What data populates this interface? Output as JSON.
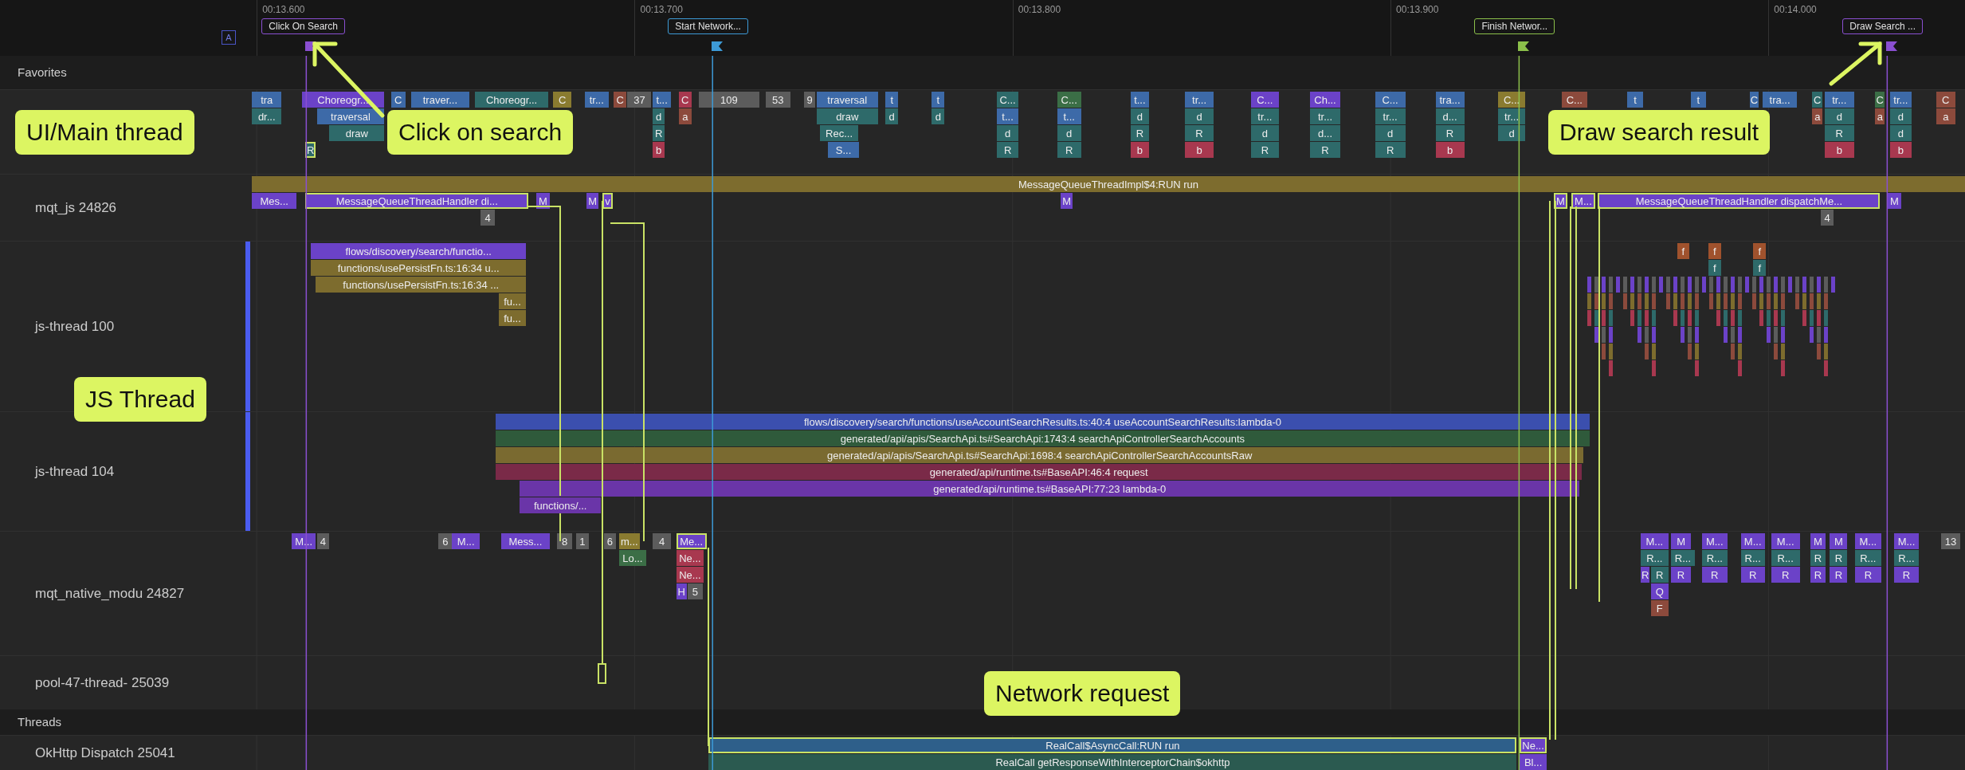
{
  "timeline": {
    "badge": "A",
    "ticks": [
      "00:13.600",
      "00:13.700",
      "00:13.800",
      "00:13.900",
      "00:14.000"
    ],
    "markers": [
      {
        "label": "Click On Search",
        "color": "#8a4fd1"
      },
      {
        "label": "Start Network...",
        "color": "#3d9ad6"
      },
      {
        "label": "Finish Networ...",
        "color": "#8cc04a"
      },
      {
        "label": "Draw Search ...",
        "color": "#8a4fd1"
      }
    ]
  },
  "tracks": [
    {
      "kind": "header",
      "label": "Favorites"
    },
    {
      "kind": "track",
      "bracketed": false,
      "lanes": [
        {
          "slices": [
            {
              "text": "tra",
              "color": "#3d6aa8",
              "outlined": false
            },
            {
              "text": "Choreogr...",
              "color": "#6b42c8",
              "outlined": false
            },
            {
              "text": "C",
              "color": "#3d6aa8",
              "outlined": false
            },
            {
              "text": "traver...",
              "color": "#3d6aa8",
              "outlined": false
            },
            {
              "text": "Choreogr...",
              "color": "#2e6a6a",
              "outlined": false
            },
            {
              "text": "C",
              "color": "#8a7b30",
              "outlined": false
            },
            {
              "text": "tr...",
              "color": "#3d6aa8",
              "outlined": false
            },
            {
              "text": "C",
              "color": "#8c4a3c",
              "outlined": false
            },
            {
              "text": "37",
              "color": "#5c5c5c",
              "outlined": false
            },
            {
              "text": "t...",
              "color": "#3d6aa8",
              "outlined": false
            },
            {
              "text": "C",
              "color": "#a8384f",
              "outlined": false
            },
            {
              "text": "109",
              "color": "#5c5c5c",
              "outlined": false
            },
            {
              "text": "53",
              "color": "#5c5c5c",
              "outlined": false
            },
            {
              "text": "9",
              "color": "#5c5c5c",
              "outlined": false
            },
            {
              "text": "traversal",
              "color": "#3d6aa8",
              "outlined": false
            },
            {
              "text": "t",
              "color": "#3d6aa8",
              "outlined": false
            },
            {
              "text": "t",
              "color": "#3d6aa8",
              "outlined": false
            },
            {
              "text": "C...",
              "color": "#2e6a6a",
              "outlined": false
            },
            {
              "text": "C...",
              "color": "#3b6e46",
              "outlined": false
            },
            {
              "text": "t...",
              "color": "#3d6aa8",
              "outlined": false
            },
            {
              "text": "tr...",
              "color": "#3d6aa8",
              "outlined": false
            },
            {
              "text": "C...",
              "color": "#6b42c8",
              "outlined": false
            },
            {
              "text": "Ch...",
              "color": "#6b42c8",
              "outlined": false
            },
            {
              "text": "C...",
              "color": "#3d6aa8",
              "outlined": false
            },
            {
              "text": "tra...",
              "color": "#3d6aa8",
              "outlined": false
            },
            {
              "text": "C...",
              "color": "#8a7b30",
              "outlined": false
            },
            {
              "text": "C...",
              "color": "#8c4a3c",
              "outlined": false
            },
            {
              "text": "t",
              "color": "#3d6aa8",
              "outlined": false
            },
            {
              "text": "t",
              "color": "#3d6aa8",
              "outlined": false
            },
            {
              "text": "C",
              "color": "#3d6aa8",
              "outlined": false
            },
            {
              "text": "tra...",
              "color": "#3d6aa8",
              "outlined": false
            },
            {
              "text": "C",
              "color": "#2e6a6a",
              "outlined": false
            },
            {
              "text": "tr...",
              "color": "#3d6aa8",
              "outlined": false
            },
            {
              "text": "C",
              "color": "#3b6e46",
              "outlined": false
            },
            {
              "text": "tr...",
              "color": "#3d6aa8",
              "outlined": false
            },
            {
              "text": "C",
              "color": "#8c4a3c",
              "outlined": false
            }
          ]
        },
        {
          "slices": [
            {
              "text": "dr...",
              "color": "#2e6a6a",
              "outlined": false
            },
            {
              "text": "traversal",
              "color": "#3d6aa8",
              "outlined": false
            },
            {
              "text": "d",
              "color": "#2e6a6a",
              "outlined": false
            },
            {
              "text": "a",
              "color": "#8c4a3c",
              "outlined": false
            },
            {
              "text": "draw",
              "color": "#2e6a6a",
              "outlined": false
            },
            {
              "text": "d",
              "color": "#2e6a6a",
              "outlined": false
            },
            {
              "text": "d",
              "color": "#2e6a6a",
              "outlined": false
            },
            {
              "text": "t...",
              "color": "#3d6aa8",
              "outlined": false
            },
            {
              "text": "t...",
              "color": "#3d6aa8",
              "outlined": false
            },
            {
              "text": "d",
              "color": "#2e6a6a",
              "outlined": false
            },
            {
              "text": "d",
              "color": "#2e6a6a",
              "outlined": false
            },
            {
              "text": "tr...",
              "color": "#2e6a6a",
              "outlined": false
            },
            {
              "text": "tr...",
              "color": "#2e6a6a",
              "outlined": false
            },
            {
              "text": "tr...",
              "color": "#2e6a6a",
              "outlined": false
            },
            {
              "text": "d...",
              "color": "#2e6a6a",
              "outlined": false
            },
            {
              "text": "tr...",
              "color": "#2e6a6a",
              "outlined": false
            },
            {
              "text": "a",
              "color": "#8c4a3c",
              "outlined": false
            },
            {
              "text": "d",
              "color": "#2e6a6a",
              "outlined": false
            },
            {
              "text": "a",
              "color": "#8c4a3c",
              "outlined": false
            },
            {
              "text": "d",
              "color": "#2e6a6a",
              "outlined": false
            },
            {
              "text": "a",
              "color": "#8c4a3c",
              "outlined": false
            }
          ]
        },
        {
          "slices": [
            {
              "text": "draw",
              "color": "#2e6a6a",
              "outlined": false
            },
            {
              "text": "R",
              "color": "#2e6a6a",
              "outlined": false
            },
            {
              "text": "Rec...",
              "color": "#2e6a6a",
              "outlined": false
            },
            {
              "text": "d",
              "color": "#2e6a6a",
              "outlined": false
            },
            {
              "text": "d",
              "color": "#2e6a6a",
              "outlined": false
            },
            {
              "text": "R",
              "color": "#2e6a6a",
              "outlined": false
            },
            {
              "text": "R",
              "color": "#2e6a6a",
              "outlined": false
            },
            {
              "text": "d",
              "color": "#2e6a6a",
              "outlined": false
            },
            {
              "text": "d...",
              "color": "#2e6a6a",
              "outlined": false
            },
            {
              "text": "d",
              "color": "#2e6a6a",
              "outlined": false
            },
            {
              "text": "R",
              "color": "#2e6a6a",
              "outlined": false
            },
            {
              "text": "d",
              "color": "#2e6a6a",
              "outlined": false
            },
            {
              "text": "R",
              "color": "#2e6a6a",
              "outlined": false
            },
            {
              "text": "d",
              "color": "#2e6a6a",
              "outlined": false
            }
          ]
        },
        {
          "slices": [
            {
              "text": "R",
              "color": "#2e6a6a",
              "outlined": true
            },
            {
              "text": "b",
              "color": "#a8384f",
              "outlined": false
            },
            {
              "text": "S...",
              "color": "#3d6aa8",
              "outlined": false
            },
            {
              "text": "R",
              "color": "#2e6a6a",
              "outlined": false
            },
            {
              "text": "R",
              "color": "#2e6a6a",
              "outlined": false
            },
            {
              "text": "b",
              "color": "#a8384f",
              "outlined": false
            },
            {
              "text": "b",
              "color": "#a8384f",
              "outlined": false
            },
            {
              "text": "R",
              "color": "#2e6a6a",
              "outlined": false
            },
            {
              "text": "R",
              "color": "#2e6a6a",
              "outlined": false
            },
            {
              "text": "R",
              "color": "#2e6a6a",
              "outlined": false
            },
            {
              "text": "b",
              "color": "#a8384f",
              "outlined": false
            },
            {
              "text": "b",
              "color": "#a8384f",
              "outlined": false
            },
            {
              "text": "b",
              "color": "#a8384f",
              "outlined": false
            }
          ]
        }
      ]
    },
    {
      "kind": "track",
      "label": "mqt_js 24826",
      "bracketed": false,
      "lanes": [
        {
          "slices": [
            {
              "text": "MessageQueueThreadImpl$4:RUN run",
              "color": "#7d6c2e",
              "outlined": false
            }
          ]
        },
        {
          "slices": [
            {
              "text": "Mes...",
              "color": "#6b42c8",
              "outlined": false
            },
            {
              "text": "MessageQueueThreadHandler di...",
              "color": "#6b42c8",
              "outlined": true
            },
            {
              "text": "M",
              "color": "#6b42c8",
              "outlined": false
            },
            {
              "text": "M",
              "color": "#6b42c8",
              "outlined": false
            },
            {
              "text": "v",
              "color": "#6b42c8",
              "outlined": true
            },
            {
              "text": "M",
              "color": "#6b42c8",
              "outlined": false
            },
            {
              "text": "M",
              "color": "#6b42c8",
              "outlined": true
            },
            {
              "text": "M...",
              "color": "#6b42c8",
              "outlined": true
            },
            {
              "text": "MessageQueueThreadHandler dispatchMe...",
              "color": "#6b42c8",
              "outlined": true
            },
            {
              "text": "M",
              "color": "#6b42c8",
              "outlined": false
            }
          ]
        },
        {
          "slices": [
            {
              "text": "4",
              "color": "#5c5c5c",
              "outlined": false
            },
            {
              "text": "4",
              "color": "#5c5c5c",
              "outlined": false
            }
          ]
        }
      ]
    },
    {
      "kind": "track",
      "label": "js-thread 100",
      "bracketed": true,
      "lanes": [
        {
          "slices": [
            {
              "text": "flows/discovery/search/functio...",
              "color": "#6b42c8",
              "outlined": false
            },
            {
              "text": "f",
              "color": "#a0522d",
              "outlined": false
            },
            {
              "text": "f",
              "color": "#a0522d",
              "outlined": false
            },
            {
              "text": "f",
              "color": "#a0522d",
              "outlined": false
            }
          ]
        },
        {
          "slices": [
            {
              "text": "functions/usePersistFn.ts:16:34 u...",
              "color": "#7d6c2e",
              "outlined": false
            },
            {
              "text": "f",
              "color": "#2e6a6a",
              "outlined": false
            },
            {
              "text": "f",
              "color": "#2e6a6a",
              "outlined": false
            }
          ]
        },
        {
          "slices": [
            {
              "text": "functions/usePersistFn.ts:16:34 ...",
              "color": "#7d6c2e",
              "outlined": false
            }
          ]
        },
        {
          "slices": [
            {
              "text": "fu...",
              "color": "#7d6c2e",
              "outlined": false
            }
          ]
        },
        {
          "slices": [
            {
              "text": "fu...",
              "color": "#7d6c2e",
              "outlined": false
            }
          ]
        }
      ]
    },
    {
      "kind": "track",
      "label": "js-thread 104",
      "bracketed": true,
      "lanes": [
        {
          "slices": [
            {
              "text": "flows/discovery/search/functions/useAccountSearchResults.ts:40:4 useAccountSearchResults:lambda-0",
              "color": "#3b4fae",
              "outlined": false
            }
          ]
        },
        {
          "slices": [
            {
              "text": "generated/api/apis/SearchApi.ts#SearchApi:1743:4 searchApiControllerSearchAccounts",
              "color": "#2f5a3b",
              "outlined": false
            }
          ]
        },
        {
          "slices": [
            {
              "text": "generated/api/apis/SearchApi.ts#SearchApi:1698:4 searchApiControllerSearchAccountsRaw",
              "color": "#7a6a30",
              "outlined": false
            }
          ]
        },
        {
          "slices": [
            {
              "text": "generated/api/runtime.ts#BaseAPI:46:4 request",
              "color": "#7a2a48",
              "outlined": false
            }
          ]
        },
        {
          "slices": [
            {
              "text": "generated/api/runtime.ts#BaseAPI:77:23 lambda-0",
              "color": "#6a35a8",
              "outlined": false
            }
          ]
        },
        {
          "slices": [
            {
              "text": "functions/...",
              "color": "#6a35a8",
              "outlined": false
            }
          ]
        }
      ]
    },
    {
      "kind": "track",
      "label": "mqt_native_modu 24827",
      "bracketed": false,
      "lanes": [
        {
          "slices": [
            {
              "text": "M...",
              "color": "#6b42c8",
              "outlined": false
            },
            {
              "text": "4",
              "color": "#5c5c5c",
              "outlined": false
            },
            {
              "text": "6",
              "color": "#5c5c5c",
              "outlined": false
            },
            {
              "text": "M...",
              "color": "#6b42c8",
              "outlined": false
            },
            {
              "text": "Mess...",
              "color": "#6b42c8",
              "outlined": false
            },
            {
              "text": "8",
              "color": "#5c5c5c",
              "outlined": false
            },
            {
              "text": "1",
              "color": "#5c5c5c",
              "outlined": false
            },
            {
              "text": "6",
              "color": "#5c5c5c",
              "outlined": false
            },
            {
              "text": "m...",
              "color": "#8a7b30",
              "outlined": false
            },
            {
              "text": "4",
              "color": "#5c5c5c",
              "outlined": false
            },
            {
              "text": "Me...",
              "color": "#6b42c8",
              "outlined": true
            },
            {
              "text": "M...",
              "color": "#6b42c8",
              "outlined": false
            },
            {
              "text": "M",
              "color": "#6b42c8",
              "outlined": false
            },
            {
              "text": "M...",
              "color": "#6b42c8",
              "outlined": false
            },
            {
              "text": "M...",
              "color": "#6b42c8",
              "outlined": false
            },
            {
              "text": "M...",
              "color": "#6b42c8",
              "outlined": false
            },
            {
              "text": "M",
              "color": "#6b42c8",
              "outlined": false
            },
            {
              "text": "M",
              "color": "#6b42c8",
              "outlined": false
            },
            {
              "text": "M...",
              "color": "#6b42c8",
              "outlined": false
            },
            {
              "text": "M...",
              "color": "#6b42c8",
              "outlined": false
            },
            {
              "text": "13",
              "color": "#5c5c5c",
              "outlined": false
            }
          ]
        },
        {
          "slices": [
            {
              "text": "Lo...",
              "color": "#3b6e46",
              "outlined": false
            },
            {
              "text": "Ne...",
              "color": "#a8384f",
              "outlined": false
            },
            {
              "text": "R...",
              "color": "#2e6a6a",
              "outlined": false
            },
            {
              "text": "R...",
              "color": "#2e6a6a",
              "outlined": false
            },
            {
              "text": "R...",
              "color": "#2e6a6a",
              "outlined": false
            },
            {
              "text": "R...",
              "color": "#2e6a6a",
              "outlined": false
            },
            {
              "text": "R...",
              "color": "#2e6a6a",
              "outlined": false
            },
            {
              "text": "R",
              "color": "#2e6a6a",
              "outlined": false
            },
            {
              "text": "R",
              "color": "#2e6a6a",
              "outlined": false
            },
            {
              "text": "R...",
              "color": "#2e6a6a",
              "outlined": false
            },
            {
              "text": "R...",
              "color": "#2e6a6a",
              "outlined": false
            }
          ]
        },
        {
          "slices": [
            {
              "text": "Ne...",
              "color": "#a8384f",
              "outlined": false
            },
            {
              "text": "R",
              "color": "#6b42c8",
              "outlined": false
            },
            {
              "text": "R",
              "color": "#2e6a6a",
              "outlined": false
            },
            {
              "text": "R",
              "color": "#6b42c8",
              "outlined": false
            },
            {
              "text": "R",
              "color": "#6b42c8",
              "outlined": false
            },
            {
              "text": "R",
              "color": "#6b42c8",
              "outlined": false
            },
            {
              "text": "R",
              "color": "#6b42c8",
              "outlined": false
            },
            {
              "text": "R",
              "color": "#6b42c8",
              "outlined": false
            },
            {
              "text": "R",
              "color": "#6b42c8",
              "outlined": false
            },
            {
              "text": "R",
              "color": "#6b42c8",
              "outlined": false
            },
            {
              "text": "R",
              "color": "#6b42c8",
              "outlined": false
            }
          ]
        },
        {
          "slices": [
            {
              "text": "H",
              "color": "#6b42c8",
              "outlined": false
            },
            {
              "text": "5",
              "color": "#5c5c5c",
              "outlined": false
            },
            {
              "text": "Q",
              "color": "#6b42c8",
              "outlined": false
            }
          ]
        },
        {
          "slices": [
            {
              "text": "F",
              "color": "#8c4a3c",
              "outlined": false
            }
          ]
        }
      ]
    },
    {
      "kind": "track",
      "label": "pool-47-thread- 25039",
      "bracketed": false
    },
    {
      "kind": "header",
      "label": "Threads"
    },
    {
      "kind": "track",
      "label": "OkHttp Dispatch 25041",
      "bracketed": false,
      "lanes": [
        {
          "slices": [
            {
              "text": "RealCall$AsyncCall:RUN run",
              "color": "#2e5f8a",
              "outlined": true
            },
            {
              "text": "Ne...",
              "color": "#6b42c8",
              "outlined": true
            }
          ]
        },
        {
          "slices": [
            {
              "text": "RealCall getResponseWithInterceptorChain$okhttp",
              "color": "#2b5a50",
              "outlined": false
            },
            {
              "text": "Bl...",
              "color": "#6b42c8",
              "outlined": false
            }
          ]
        }
      ]
    }
  ],
  "callouts": [
    {
      "text": "UI/Main thread"
    },
    {
      "text": "Click on search"
    },
    {
      "text": "Draw search result"
    },
    {
      "text": "JS Thread"
    },
    {
      "text": "Network request"
    }
  ]
}
